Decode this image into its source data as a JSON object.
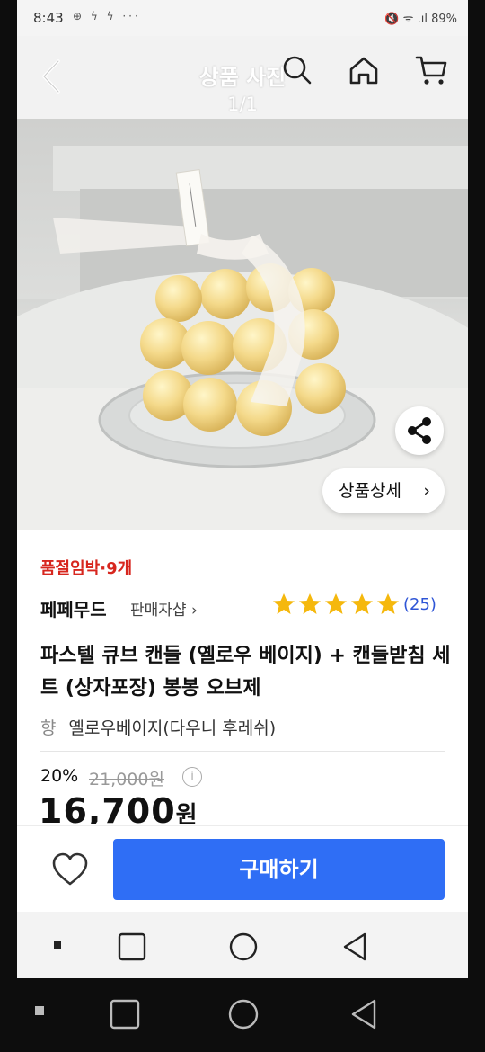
{
  "status_bar": {
    "time": "8:43",
    "left_icons": "⊕ ϟ ϟ ···",
    "right_icons": "🔇 ᯤ .ıl 89%"
  },
  "header": {
    "title": "상품 사진",
    "counter": "1/1",
    "icons": [
      "back-icon",
      "search-icon",
      "home-icon",
      "cart-icon"
    ]
  },
  "photo": {
    "alt": "pastel bubble cube candle on glass holder",
    "share_icon": "share-icon",
    "detail_button_label": "상품상세",
    "detail_chevron": "›"
  },
  "product": {
    "stock_badge": "품절임박·9개",
    "seller_name": "페페무드",
    "seller_tag": "판매자샵",
    "seller_chevron": "›",
    "rating_stars": 5,
    "review_count": "(25)",
    "name": "파스텔 큐브 캔들 (옐로우 베이지) + 캔들받침 세트 (상자포장) 봉봉 오브제",
    "option_label": "향",
    "option_value": "옐로우베이지(다우니 후레쉬)",
    "discount_rate": "20%",
    "original_price": "21,000원",
    "price_value": "16,700",
    "price_unit": "원"
  },
  "buy_bar": {
    "wishlist_icon": "heart-icon",
    "buy_label": "구매하기"
  },
  "colors": {
    "accent_blue": "#2f6ef5",
    "stock_red": "#d7261e",
    "star_yellow": "#f5b80d",
    "review_blue": "#2e55d6"
  }
}
